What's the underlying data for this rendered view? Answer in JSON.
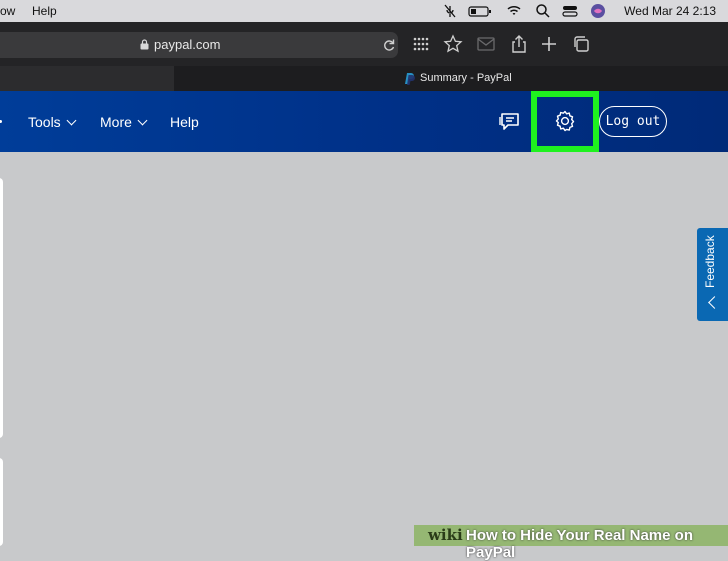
{
  "menubar": {
    "items": [
      "ow",
      "Help"
    ],
    "date_time": "Wed Mar 24  2:13"
  },
  "browser": {
    "url": "paypal.com",
    "tab_title": "Summary - PayPal"
  },
  "nav": {
    "items": [
      {
        "label": "Tools"
      },
      {
        "label": "More"
      },
      {
        "label": "Help"
      }
    ],
    "logout_label": "Log out"
  },
  "feedback_label": "Feedback",
  "watermark": {
    "brand": "wiki",
    "title": "How to Hide Your Real Name on PayPal"
  },
  "colors": {
    "nav_bg": "#003087",
    "highlight": "#1ff11f",
    "feedback_bg": "#0a68b3"
  }
}
